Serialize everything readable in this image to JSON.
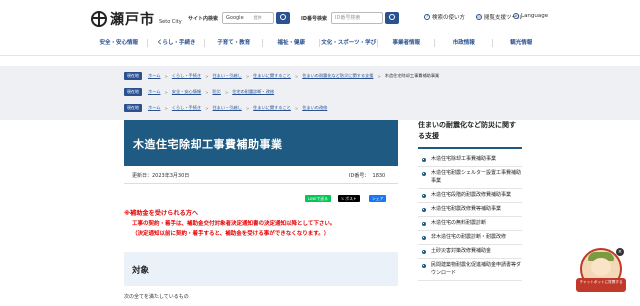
{
  "header": {
    "logo_name": "瀬戸市",
    "logo_sub": "Seto City",
    "site_search_label": "サイト内検索",
    "site_search_value": "Google",
    "site_search_tag": "提供",
    "id_search_label": "ID番号検索",
    "id_search_placeholder": "ID番号検索",
    "util_help": "検索の使い方",
    "util_tools": "閲覧支援ツール",
    "util_language": "Language"
  },
  "gnav": [
    "安全・安心情報",
    "くらし・手続き",
    "子育て・教育",
    "福祉・健康",
    "文化・スポーツ・学び",
    "事業者情報",
    "市政情報",
    "観光情報"
  ],
  "breadcrumbs": [
    {
      "badge": "現在地",
      "crumbs": [
        "ホーム",
        "くらし・手続き",
        "住まい・引越し",
        "住まいに関すること",
        "住まいの耐震化など防災に関する支援"
      ],
      "current": "木造住宅除却工事費補助事業"
    },
    {
      "badge": "現在地",
      "crumbs": [
        "ホーム",
        "安全・安心情報",
        "防災",
        "住宅の耐震診断・改修"
      ],
      "current": ""
    },
    {
      "badge": "現在地",
      "crumbs": [
        "ホーム",
        "くらし・手続き",
        "住まい・引越し",
        "住まいに関すること",
        "住まいの改修"
      ],
      "current": ""
    }
  ],
  "page": {
    "title": "木造住宅除却工事費補助事業",
    "updated": "更新日：2023年3月30日",
    "id_label": "ID番号：",
    "id_value": "1830",
    "share_line": "LINEで送る",
    "share_x": "ポスト",
    "share_fb": "シェア",
    "notice_heading": "※補助金を受けられる方へ",
    "notice_line1": "工事の契約・着手は、補助金交付対象者決定通知書の決定通知以降として下さい。",
    "notice_line2": "（決定通知以前に契約・着手すると、補助金を受ける事ができなくなります。）",
    "section_heading": "対象",
    "body_text": "次の全てを満たしているもの"
  },
  "sidebar": {
    "title": "住まいの耐震化など防災に関する支援",
    "items": [
      "木造住宅除却工事費補助事業",
      "木造住宅耐震シェルター設置工事費補助事業",
      "木造住宅段階的耐震改修費補助事業",
      "木造住宅耐震改修費等補助事業",
      "木造住宅の無料耐震診断",
      "非木造住宅の耐震診断・耐震改修",
      "土砂災害対策改修費補助金",
      "民間建築物耐震化促進補助金申請書等ダウンロード"
    ]
  },
  "chatbot": {
    "label": "チャットボットに質問する"
  },
  "colors": {
    "brand": "#2b5290",
    "title_bg": "#1e5a82",
    "notice": "#e60000"
  }
}
